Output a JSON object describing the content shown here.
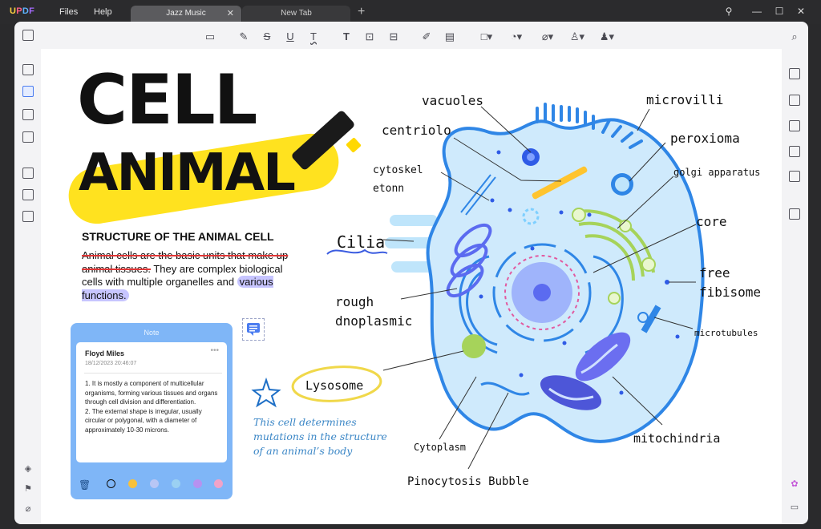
{
  "app": {
    "logo": "UPDF",
    "menu": [
      "Files",
      "Help"
    ],
    "tabs": [
      {
        "label": "Jazz Music",
        "active": true
      },
      {
        "label": "New Tab",
        "active": false
      }
    ]
  },
  "colors": {
    "accent": "#4a7cf0",
    "highlight_yellow": "#ffe21f",
    "note_blue": "#7fb6f7",
    "cell_blue": "#bfe5fb",
    "organelle_blue": "#2f86e6"
  },
  "toolbar_icons": [
    "comment-icon",
    "pen-highlight-icon",
    "strikethrough-icon",
    "underline-icon",
    "squiggly-underline-icon",
    "text-icon",
    "textbox-icon",
    "text-callout-icon",
    "pencil-icon",
    "eraser-icon",
    "shape-icon",
    "sticker-icon",
    "attach-icon",
    "stamp-icon",
    "signature-icon"
  ],
  "document": {
    "title_line1": "CELL",
    "title_line2": "ANIMAL",
    "section_title": "STRUCTURE OF THE ANIMAL CELL",
    "paragraph_struck": "Animal cells are the basic units that make up animal tissues.",
    "paragraph_rest": " They are complex biological cells with multiple organelles and ",
    "paragraph_highlighted": "various functions."
  },
  "note": {
    "header": "Note",
    "author": "Floyd Miles",
    "date": "18/12/2023 20:46:07",
    "text": "1. It is mostly a component of multicellular organisms, forming various tissues and organs through cell division and differentiation.\n2. The external shape is irregular, usually circular or polygonal, with a diameter of approximately 10-30 microns."
  },
  "diagram": {
    "labels": {
      "vacuoles": "vacuoles",
      "microvilli": "microvilli",
      "centriolo": "centriolo",
      "peroxioma": "peroxioma",
      "cytoskel1": "cytoskel",
      "cytoskel2": "etonn",
      "golgi": "golgi apparatus",
      "core": "core",
      "cilia": "Cilia",
      "free1": "free",
      "free2": "fibisome",
      "rough1": "rough",
      "rough2": "dnoplasmic",
      "microtubules": "microtubules",
      "lysosome": "Lysosome",
      "cytoplasm": "Cytoplasm",
      "mitochondria": "mitochindria",
      "pinocytosis": "Pinocytosis Bubble"
    },
    "script_note": "This cell determines\nmutations in the structure\nof an animal’s body"
  }
}
